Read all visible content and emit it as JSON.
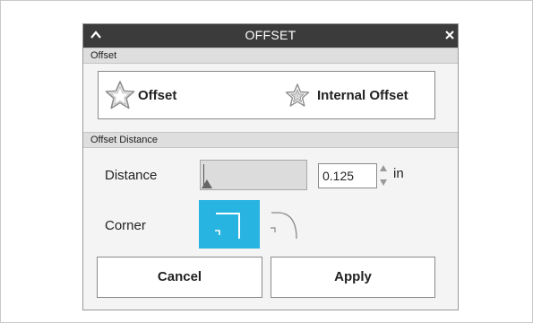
{
  "dialog": {
    "title": "OFFSET",
    "collapse_icon": "chevron-up-icon",
    "close_icon": "close-icon"
  },
  "offset_section": {
    "header": "Offset",
    "options": [
      {
        "label": "Offset",
        "icon": "star-outline-icon"
      },
      {
        "label": "Internal Offset",
        "icon": "star-inset-icon"
      }
    ]
  },
  "distance_section": {
    "header": "Offset Distance",
    "distance_label": "Distance",
    "distance_value": "0.125",
    "distance_unit": "in",
    "corner_label": "Corner",
    "corner_options": [
      {
        "icon": "square-corner-icon",
        "selected": true
      },
      {
        "icon": "round-corner-icon",
        "selected": false
      }
    ]
  },
  "buttons": {
    "cancel": "Cancel",
    "apply": "Apply"
  },
  "colors": {
    "titlebar": "#3b3b3b",
    "selected_corner": "#27b4e0"
  }
}
